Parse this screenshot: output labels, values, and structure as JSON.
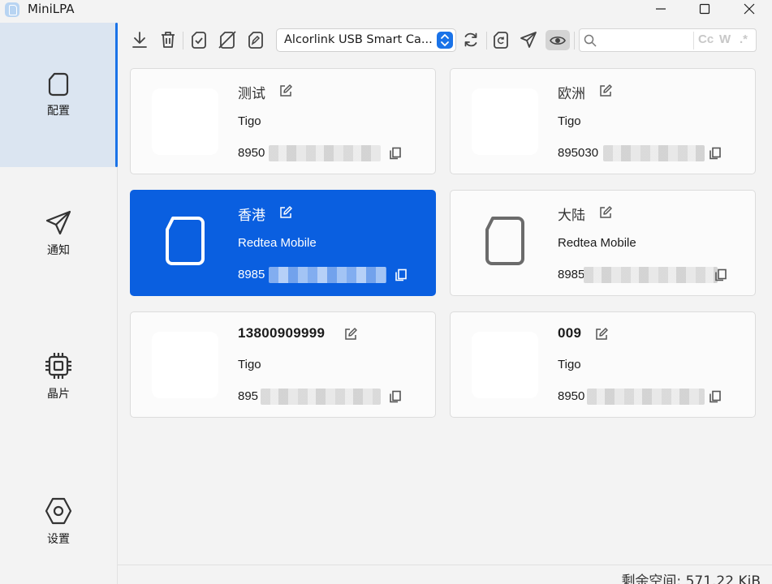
{
  "window": {
    "title": "MiniLPA"
  },
  "sidebar": {
    "items": [
      {
        "label": "配置",
        "icon": "sim-card-icon",
        "active": true
      },
      {
        "label": "通知",
        "icon": "paper-plane-icon",
        "active": false
      },
      {
        "label": "晶片",
        "icon": "chip-icon",
        "active": false
      },
      {
        "label": "设置",
        "icon": "hexagon-settings-icon",
        "active": false
      }
    ]
  },
  "toolbar": {
    "icons": [
      "download-icon",
      "delete-icon",
      "enable-profile-icon",
      "disable-profile-icon",
      "rename-icon"
    ],
    "reader_selected": "Alcorlink USB Smart Ca...",
    "right_icons": [
      "refresh-icon",
      "reset-icon",
      "send-notification-icon",
      "eye-icon"
    ],
    "search": {
      "value": "",
      "placeholder": "",
      "opt_case": "Cc",
      "opt_word": "W",
      "opt_regex": ".*"
    }
  },
  "profiles": [
    {
      "name": "测试",
      "carrier": "Tigo",
      "iccid_prefix": "8950",
      "selected": false,
      "icon_style": "blank"
    },
    {
      "name": "欧洲",
      "carrier": "Tigo",
      "iccid_prefix": "895030",
      "selected": false,
      "icon_style": "blank"
    },
    {
      "name": "香港",
      "carrier": "Redtea Mobile",
      "iccid_prefix": "8985",
      "selected": true,
      "icon_style": "sim-outline-white"
    },
    {
      "name": "大陆",
      "carrier": "Redtea Mobile",
      "iccid_prefix": "8985",
      "selected": false,
      "icon_style": "sim-outline-gray"
    },
    {
      "name": "13800909999",
      "carrier": "Tigo",
      "iccid_prefix": "895",
      "selected": false,
      "icon_style": "blank"
    },
    {
      "name": "009",
      "carrier": "Tigo",
      "iccid_prefix": "8950",
      "selected": false,
      "icon_style": "blank"
    }
  ],
  "footer": {
    "free_space": "剩余空间: 571.22 KiB"
  },
  "colors": {
    "accent": "#0a5fe0",
    "sidebar_active": "#dbe5f1"
  }
}
